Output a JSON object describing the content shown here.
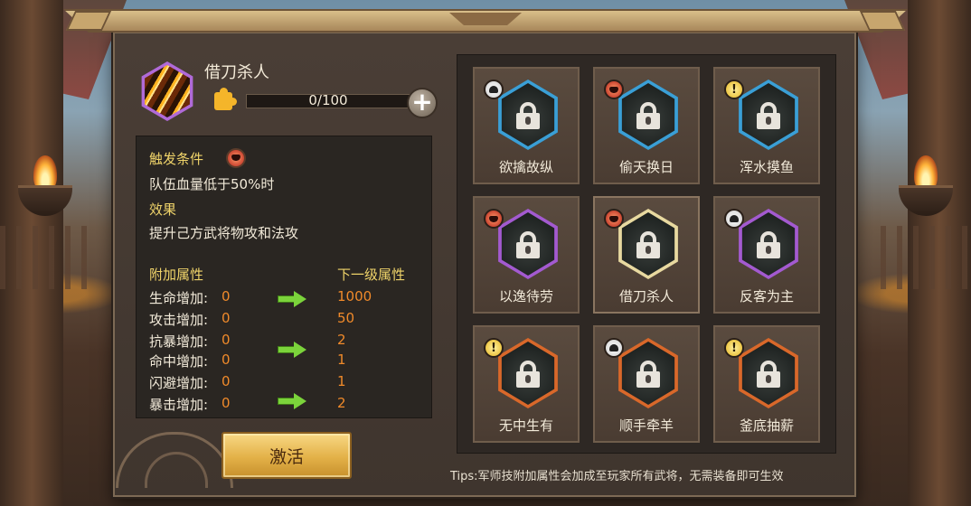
{
  "skill": {
    "name": "借刀杀人",
    "fragments": "0/100",
    "progress_fraction": 0.0
  },
  "info": {
    "trigger_title": "触发条件",
    "trigger_text": "队伍血量低于50%时",
    "effect_title": "效果",
    "effect_text": "提升己方武将物攻和法攻",
    "attr_header": "附加属性",
    "next_header": "下一级属性",
    "attributes": [
      {
        "label": "生命增加:",
        "current": "0",
        "next": "1000"
      },
      {
        "label": "攻击增加:",
        "current": "0",
        "next": "50"
      },
      {
        "label": "抗暴增加:",
        "current": "0",
        "next": "2"
      },
      {
        "label": "命中增加:",
        "current": "0",
        "next": "1"
      },
      {
        "label": "闪避增加:",
        "current": "0",
        "next": "1"
      },
      {
        "label": "暴击增加:",
        "current": "0",
        "next": "2"
      }
    ]
  },
  "activate_label": "激活",
  "strategies": [
    {
      "name": "欲擒故纵",
      "badge": "skull-icon",
      "frame": "#3a9fd6"
    },
    {
      "name": "偷天换日",
      "badge": "red-face-icon",
      "frame": "#3a9fd6"
    },
    {
      "name": "浑水摸鱼",
      "badge": "exclaim-icon",
      "frame": "#3a9fd6"
    },
    {
      "name": "以逸待劳",
      "badge": "red-face-icon",
      "frame": "#a35ad0"
    },
    {
      "name": "借刀杀人",
      "badge": "red-face-icon",
      "frame": "#e8d9a0"
    },
    {
      "name": "反客为主",
      "badge": "skull-icon",
      "frame": "#a35ad0"
    },
    {
      "name": "无中生有",
      "badge": "exclaim-icon",
      "frame": "#d9682a"
    },
    {
      "name": "顺手牵羊",
      "badge": "skull-icon",
      "frame": "#d9682a"
    },
    {
      "name": "釜底抽薪",
      "badge": "exclaim-icon",
      "frame": "#d9682a"
    }
  ],
  "tips": "Tips:军师技附加属性会加成至玩家所有武将，无需装备即可生效"
}
